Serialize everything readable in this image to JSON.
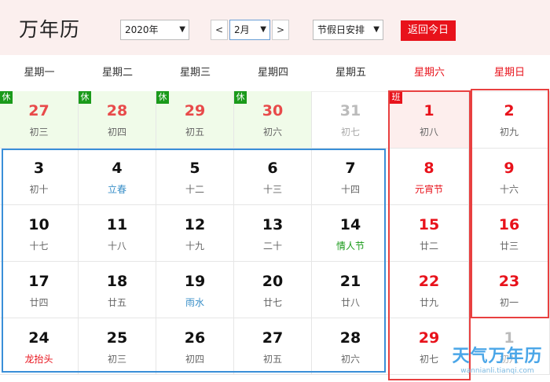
{
  "header": {
    "title": "万年历",
    "year_select": "2020年",
    "month_select": "2月",
    "prev_label": "<",
    "next_label": ">",
    "holiday_select": "节假日安排",
    "today_button": "返回今日"
  },
  "weekdays": [
    "星期一",
    "星期二",
    "星期三",
    "星期四",
    "星期五",
    "星期六",
    "星期日"
  ],
  "weeks": [
    [
      {
        "day": "27",
        "lunar": "初三",
        "tag": "休",
        "style": "green"
      },
      {
        "day": "28",
        "lunar": "初四",
        "tag": "休",
        "style": "green"
      },
      {
        "day": "29",
        "lunar": "初五",
        "tag": "休",
        "style": "green"
      },
      {
        "day": "30",
        "lunar": "初六",
        "tag": "休",
        "style": "green"
      },
      {
        "day": "31",
        "lunar": "初七",
        "tag": "",
        "style": "other"
      },
      {
        "day": "1",
        "lunar": "初八",
        "tag": "班",
        "style": "pink"
      },
      {
        "day": "2",
        "lunar": "初九",
        "tag": "",
        "style": "weekend"
      }
    ],
    [
      {
        "day": "3",
        "lunar": "初十"
      },
      {
        "day": "4",
        "lunar": "立春",
        "lunarStyle": "blue"
      },
      {
        "day": "5",
        "lunar": "十二"
      },
      {
        "day": "6",
        "lunar": "十三"
      },
      {
        "day": "7",
        "lunar": "十四"
      },
      {
        "day": "8",
        "lunar": "元宵节",
        "style": "weekend",
        "lunarStyle": "red"
      },
      {
        "day": "9",
        "lunar": "十六",
        "style": "weekend"
      }
    ],
    [
      {
        "day": "10",
        "lunar": "十七"
      },
      {
        "day": "11",
        "lunar": "十八"
      },
      {
        "day": "12",
        "lunar": "十九"
      },
      {
        "day": "13",
        "lunar": "二十"
      },
      {
        "day": "14",
        "lunar": "情人节",
        "lunarStyle": "green"
      },
      {
        "day": "15",
        "lunar": "廿二",
        "style": "weekend"
      },
      {
        "day": "16",
        "lunar": "廿三",
        "style": "weekend"
      }
    ],
    [
      {
        "day": "17",
        "lunar": "廿四"
      },
      {
        "day": "18",
        "lunar": "廿五"
      },
      {
        "day": "19",
        "lunar": "雨水",
        "lunarStyle": "blue"
      },
      {
        "day": "20",
        "lunar": "廿七"
      },
      {
        "day": "21",
        "lunar": "廿八"
      },
      {
        "day": "22",
        "lunar": "廿九",
        "style": "weekend"
      },
      {
        "day": "23",
        "lunar": "初一",
        "style": "weekend"
      }
    ],
    [
      {
        "day": "24",
        "lunar": "龙抬头",
        "lunarStyle": "red"
      },
      {
        "day": "25",
        "lunar": "初三"
      },
      {
        "day": "26",
        "lunar": "初四"
      },
      {
        "day": "27",
        "lunar": "初五"
      },
      {
        "day": "28",
        "lunar": "初六"
      },
      {
        "day": "29",
        "lunar": "初七",
        "style": "weekend"
      },
      {
        "day": "1",
        "lunar": "初八",
        "style": "other"
      }
    ]
  ],
  "watermark": {
    "title": "天气万年历",
    "url": "wannianli.tianqi.com"
  },
  "colors": {
    "accent": "#e8121b",
    "rest_tag": "#1a9a1a",
    "highlight_blue": "#3a8fd8",
    "highlight_red": "#e84040"
  }
}
